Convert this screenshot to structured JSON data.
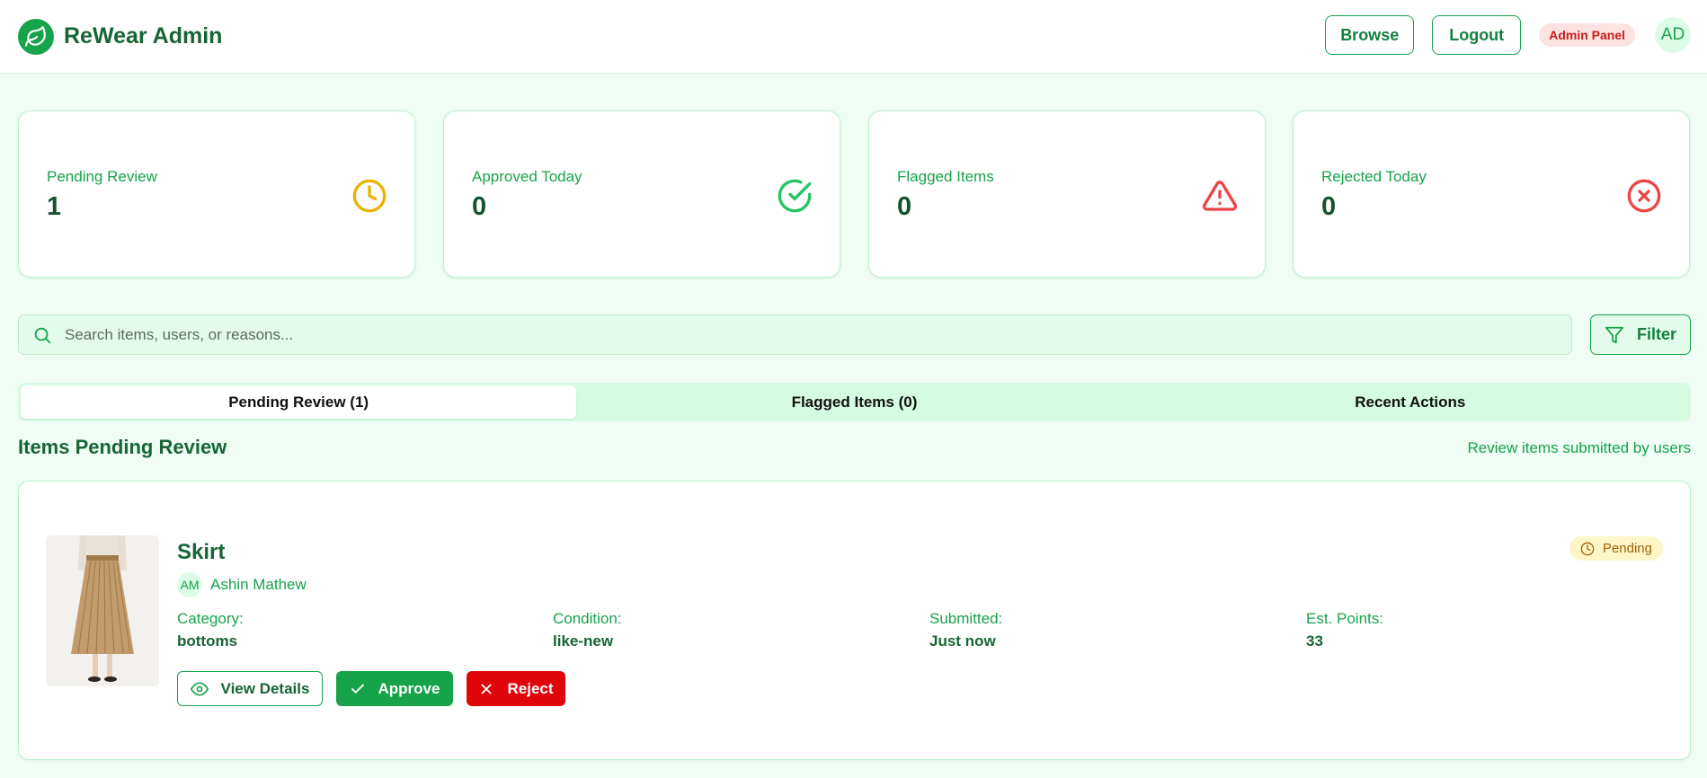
{
  "app": {
    "brand": "ReWear Admin",
    "browse_label": "Browse",
    "logout_label": "Logout",
    "admin_badge": "Admin Panel",
    "user_initials": "AD"
  },
  "stats": [
    {
      "label": "Pending Review",
      "value": "1",
      "icon": "clock-icon",
      "color": "#eab308"
    },
    {
      "label": "Approved Today",
      "value": "0",
      "icon": "check-circle-icon",
      "color": "#22c55e"
    },
    {
      "label": "Flagged Items",
      "value": "0",
      "icon": "warning-triangle-icon",
      "color": "#ef4444"
    },
    {
      "label": "Rejected Today",
      "value": "0",
      "icon": "x-circle-icon",
      "color": "#ef4444"
    }
  ],
  "search": {
    "placeholder": "Search items, users, or reasons...",
    "filter_label": "Filter"
  },
  "tabs": [
    {
      "label": "Pending Review (1)",
      "active": true
    },
    {
      "label": "Flagged Items (0)",
      "active": false
    },
    {
      "label": "Recent Actions",
      "active": false
    }
  ],
  "section": {
    "title": "Items Pending Review",
    "subtitle": "Review items submitted by users"
  },
  "item": {
    "title": "Skirt",
    "user_initials": "AM",
    "user_name": "Ashin Mathew",
    "status": "Pending",
    "meta": [
      {
        "label": "Category:",
        "value": "bottoms"
      },
      {
        "label": "Condition:",
        "value": "like-new"
      },
      {
        "label": "Submitted:",
        "value": "Just now"
      },
      {
        "label": "Est. Points:",
        "value": "33"
      }
    ],
    "actions": {
      "view": "View Details",
      "approve": "Approve",
      "reject": "Reject"
    }
  },
  "colors": {
    "primary": "#16a34a",
    "page_bg": "#effdf4",
    "danger": "#e0040b",
    "pending": "#eab308"
  }
}
